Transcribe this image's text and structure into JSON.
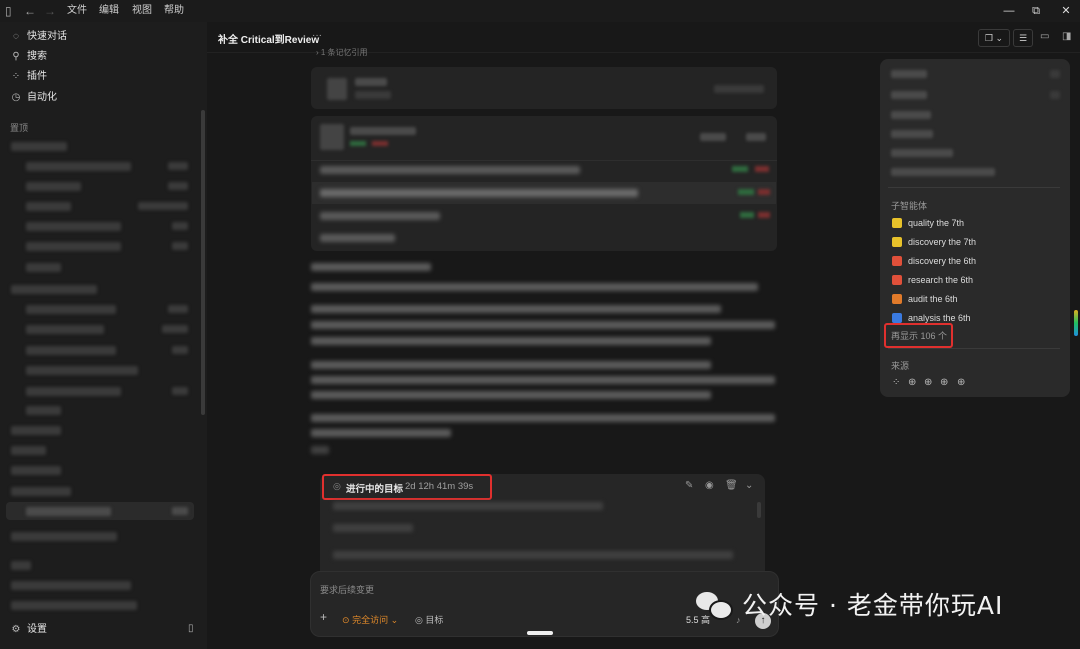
{
  "menu": [
    "文件",
    "编辑",
    "视图",
    "帮助"
  ],
  "sidebar": {
    "items": [
      {
        "label": "快速对话",
        "icon": "chat-bubble-icon"
      },
      {
        "label": "搜索",
        "icon": "search-icon"
      },
      {
        "label": "插件",
        "icon": "grid-icon"
      },
      {
        "label": "自动化",
        "icon": "clock-icon"
      }
    ],
    "section_label": "置顶",
    "settings_label": "设置"
  },
  "header": {
    "title": "补全 Critical到Review",
    "more": "···"
  },
  "thread": {
    "collapsed_label": "› 1 条记忆引用"
  },
  "panel": {
    "subagents_label": "子智能体",
    "agents": [
      {
        "name": "quality the 7th",
        "color": "#e8c22a"
      },
      {
        "name": "discovery the 7th",
        "color": "#e8c22a"
      },
      {
        "name": "discovery the 6th",
        "color": "#e0503a"
      },
      {
        "name": "research the 6th",
        "color": "#e0503a"
      },
      {
        "name": "audit the 6th",
        "color": "#e07a2a"
      },
      {
        "name": "analysis the 6th",
        "color": "#3a7ae0"
      }
    ],
    "show_more": "再显示 106 个",
    "sources_label": "来源"
  },
  "goal": {
    "label": "进行中的目标",
    "elapsed": "2d 12h 41m 39s"
  },
  "composer": {
    "placeholder": "要求后续变更",
    "access": "完全访问",
    "goal_btn": "目标",
    "model": "5.5 高"
  },
  "watermark": "公众号 · 老金带你玩AI",
  "accent": "#e0302e"
}
